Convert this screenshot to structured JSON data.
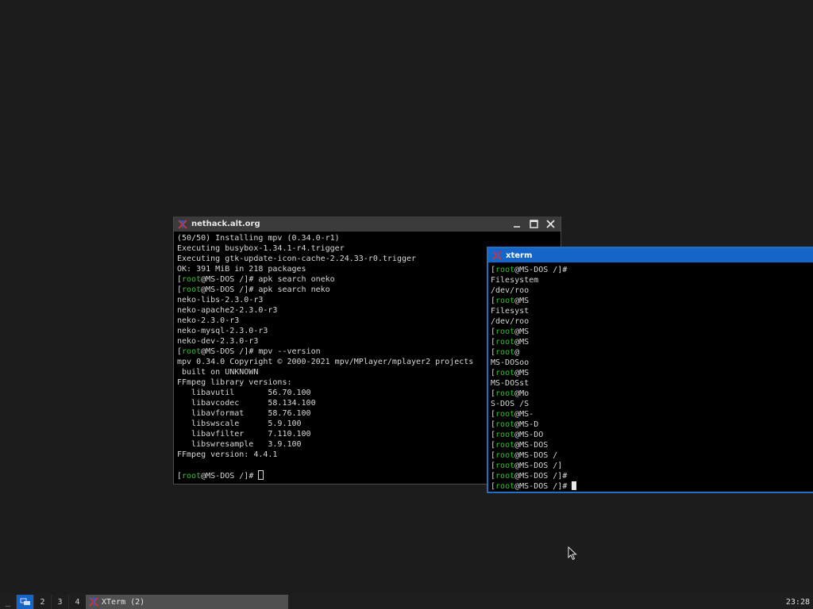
{
  "window1": {
    "title": "nethack.alt.org",
    "lines": [
      [
        {
          "t": "(50/50) Installing mpv (0.34.0-r1)"
        }
      ],
      [
        {
          "t": "Executing busybox-1.34.1-r4.trigger"
        }
      ],
      [
        {
          "t": "Executing gtk-update-icon-cache-2.24.33-r0.trigger"
        }
      ],
      [
        {
          "t": "OK: 391 MiB in 218 packages"
        }
      ],
      [
        {
          "t": "["
        },
        {
          "t": "root",
          "c": "g"
        },
        {
          "t": "@MS-DOS /]# apk search oneko"
        }
      ],
      [
        {
          "t": "["
        },
        {
          "t": "root",
          "c": "g"
        },
        {
          "t": "@MS-DOS /]# apk search neko"
        }
      ],
      [
        {
          "t": "neko-libs-2.3.0-r3"
        }
      ],
      [
        {
          "t": "neko-apache2-2.3.0-r3"
        }
      ],
      [
        {
          "t": "neko-2.3.0-r3"
        }
      ],
      [
        {
          "t": "neko-mysql-2.3.0-r3"
        }
      ],
      [
        {
          "t": "neko-dev-2.3.0-r3"
        }
      ],
      [
        {
          "t": "["
        },
        {
          "t": "root",
          "c": "g"
        },
        {
          "t": "@MS-DOS /]# mpv --version"
        }
      ],
      [
        {
          "t": "mpv 0.34.0 Copyright © 2000-2021 mpv/MPlayer/mplayer2 projects"
        }
      ],
      [
        {
          "t": " built on UNKNOWN"
        }
      ],
      [
        {
          "t": "FFmpeg library versions:"
        }
      ],
      [
        {
          "t": "   libavutil       56.70.100"
        }
      ],
      [
        {
          "t": "   libavcodec      58.134.100"
        }
      ],
      [
        {
          "t": "   libavformat     58.76.100"
        }
      ],
      [
        {
          "t": "   libswscale      5.9.100"
        }
      ],
      [
        {
          "t": "   libavfilter     7.110.100"
        }
      ],
      [
        {
          "t": "   libswresample   3.9.100"
        }
      ],
      [
        {
          "t": "FFmpeg version: 4.4.1"
        }
      ],
      [
        {
          "t": ""
        }
      ],
      [
        {
          "t": "["
        },
        {
          "t": "root",
          "c": "g"
        },
        {
          "t": "@MS-DOS /]# "
        },
        {
          "cursor": "hollow"
        }
      ]
    ]
  },
  "window2": {
    "title": "xterm",
    "lines": [
      [
        {
          "t": "["
        },
        {
          "t": "root",
          "c": "g"
        },
        {
          "t": "@MS-DOS /]#"
        }
      ],
      [
        {
          "t": "Filesystem"
        }
      ],
      [
        {
          "t": "/dev/roo"
        }
      ],
      [
        {
          "t": "["
        },
        {
          "t": "root",
          "c": "g"
        },
        {
          "t": "@MS"
        }
      ],
      [
        {
          "t": "Filesyst"
        }
      ],
      [
        {
          "t": "/dev/roo"
        }
      ],
      [
        {
          "t": "["
        },
        {
          "t": "root",
          "c": "g"
        },
        {
          "t": "@MS"
        }
      ],
      [
        {
          "t": "["
        },
        {
          "t": "root",
          "c": "g"
        },
        {
          "t": "@MS"
        }
      ],
      [
        {
          "t": "["
        },
        {
          "t": "root",
          "c": "g"
        },
        {
          "t": "@"
        }
      ],
      [
        {
          "t": "MS-DOSoo"
        }
      ],
      [
        {
          "t": "["
        },
        {
          "t": "root",
          "c": "g"
        },
        {
          "t": "@MS"
        }
      ],
      [
        {
          "t": "MS-DOSst"
        }
      ],
      [
        {
          "t": "["
        },
        {
          "t": "root",
          "c": "g"
        },
        {
          "t": "@Mo"
        }
      ],
      [
        {
          "t": "S-DOS /S"
        }
      ],
      [
        {
          "t": "["
        },
        {
          "t": "root",
          "c": "g"
        },
        {
          "t": "@MS-"
        }
      ],
      [
        {
          "t": "["
        },
        {
          "t": "root",
          "c": "g"
        },
        {
          "t": "@MS-D"
        }
      ],
      [
        {
          "t": "["
        },
        {
          "t": "root",
          "c": "g"
        },
        {
          "t": "@MS-DO"
        }
      ],
      [
        {
          "t": "["
        },
        {
          "t": "root",
          "c": "g"
        },
        {
          "t": "@MS-DOS"
        }
      ],
      [
        {
          "t": "["
        },
        {
          "t": "root",
          "c": "g"
        },
        {
          "t": "@MS-DOS /"
        }
      ],
      [
        {
          "t": "["
        },
        {
          "t": "root",
          "c": "g"
        },
        {
          "t": "@MS-DOS /]"
        }
      ],
      [
        {
          "t": "["
        },
        {
          "t": "root",
          "c": "g"
        },
        {
          "t": "@MS-DOS /]#"
        }
      ],
      [
        {
          "t": "["
        },
        {
          "t": "root",
          "c": "g"
        },
        {
          "t": "@MS-DOS /]# "
        },
        {
          "cursor": "block"
        }
      ]
    ]
  },
  "taskbar": {
    "menu_label": "_",
    "workspaces": [
      {
        "label": "1",
        "active": true
      },
      {
        "label": "2",
        "active": false
      },
      {
        "label": "3",
        "active": false
      },
      {
        "label": "4",
        "active": false
      }
    ],
    "task_label": "XTerm (2)",
    "clock": "23:28"
  },
  "colors": {
    "prompt_user": "#2fc32f",
    "active_title": "#1565c8",
    "inactive_title": "#3b3b3b",
    "desktop": "#1c1c1c"
  },
  "icons": [
    "xterm-icon",
    "minimize-icon",
    "maximize-icon",
    "close-icon",
    "workspace-icon",
    "mouse-pointer-icon"
  ]
}
